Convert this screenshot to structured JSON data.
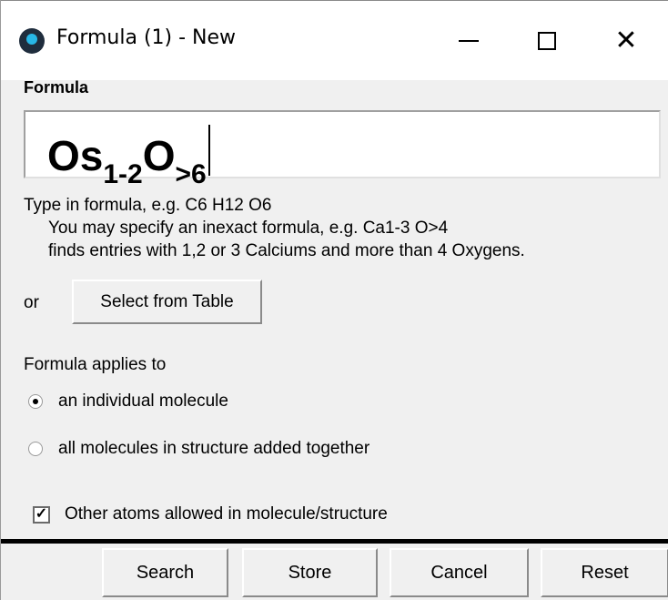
{
  "window": {
    "title": "Formula (1) - New",
    "minimize": "—",
    "maximize": "□",
    "close": "✕"
  },
  "formula": {
    "label": "Formula",
    "element1": "Os",
    "count1": "1-2",
    "element2": "O",
    "count2": ">6"
  },
  "help": {
    "line1": "Type in formula, e.g. C6 H12 O6",
    "line2": "You may specify an inexact formula, e.g. Ca1-3 O>4",
    "line3": "finds entries with 1,2 or 3 Calciums and more than 4 Oxygens."
  },
  "table": {
    "or_label": "or",
    "select_button": "Select from Table"
  },
  "applies": {
    "label": "Formula applies to",
    "options": [
      {
        "label": "an individual molecule",
        "checked": true
      },
      {
        "label": "all molecules in structure added together",
        "checked": false
      }
    ]
  },
  "other_atoms": {
    "label": "Other atoms allowed in molecule/structure",
    "checked": true
  },
  "buttons": {
    "search": "Search",
    "store": "Store",
    "cancel": "Cancel",
    "reset": "Reset"
  }
}
